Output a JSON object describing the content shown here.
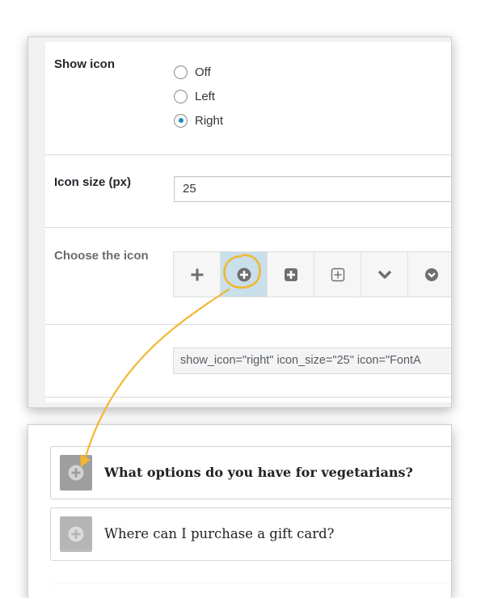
{
  "settings": {
    "show_icon": {
      "label": "Show icon",
      "options": [
        {
          "label": "Off",
          "checked": false
        },
        {
          "label": "Left",
          "checked": false
        },
        {
          "label": "Right",
          "checked": true
        }
      ]
    },
    "icon_size": {
      "label": "Icon size (px)",
      "value": "25"
    },
    "choose_icon": {
      "label": "Choose the icon",
      "icons": [
        {
          "name": "plus-icon",
          "selected": false
        },
        {
          "name": "plus-circle-icon",
          "selected": true
        },
        {
          "name": "plus-square-icon",
          "selected": false
        },
        {
          "name": "plus-square-outline-icon",
          "selected": false
        },
        {
          "name": "chevron-down-icon",
          "selected": false
        },
        {
          "name": "chevron-down-circle-icon",
          "selected": false
        }
      ]
    },
    "shortcode": "show_icon=\"right\" icon_size=\"25\" icon=\"FontA"
  },
  "preview": {
    "faq_items": [
      {
        "question": "What options do you have for vegetarians?",
        "icon": "plus-circle-icon"
      },
      {
        "question": "Where can I purchase a gift card?",
        "icon": "plus-circle-icon"
      }
    ]
  },
  "colors": {
    "accent_arrow": "#f2b632",
    "radio_checked": "#1e8cbe",
    "selected_icon_bg": "#c9dfea",
    "toggle_bg": "#9e9e9e"
  }
}
